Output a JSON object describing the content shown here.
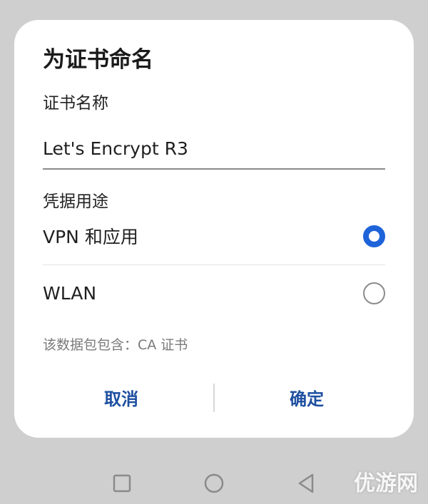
{
  "dialog": {
    "title": "为证书命名",
    "name_field": {
      "label": "证书名称",
      "value": "Let's Encrypt R3"
    },
    "usage": {
      "label": "凭据用途",
      "options": [
        {
          "label": "VPN 和应用",
          "checked": true
        },
        {
          "label": "WLAN",
          "checked": false
        }
      ]
    },
    "package_info": "该数据包包含：CA 证书",
    "buttons": {
      "cancel": "取消",
      "confirm": "确定"
    }
  },
  "navbar": {
    "icons": [
      "recent-apps-icon",
      "home-icon",
      "back-icon"
    ]
  },
  "watermark": "优游网",
  "colors": {
    "accent": "#1e63d9",
    "button_text": "#1e4fa0",
    "backdrop": "#cfcfcf"
  }
}
